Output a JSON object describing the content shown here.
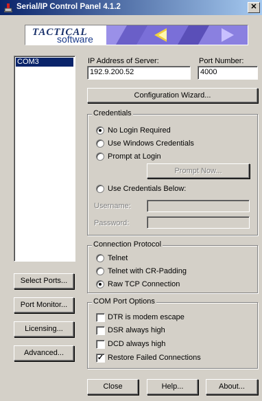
{
  "window": {
    "title": "Serial/IP Control Panel 4.1.2",
    "close_glyph": "✕"
  },
  "banner": {
    "logo_top": "TACTICAL",
    "logo_bottom": "software"
  },
  "ports": {
    "items": [
      "COM3"
    ],
    "selected": "COM3"
  },
  "server": {
    "ip_label": "IP Address of Server:",
    "ip_value": "192.9.200.52",
    "port_label": "Port Number:",
    "port_value": "4000"
  },
  "buttons": {
    "config_wizard": "Configuration Wizard...",
    "prompt_now": "Prompt Now...",
    "select_ports": "Select Ports...",
    "port_monitor": "Port Monitor...",
    "licensing": "Licensing...",
    "advanced": "Advanced...",
    "close": "Close",
    "help": "Help...",
    "about": "About..."
  },
  "credentials": {
    "legend": "Credentials",
    "options": [
      "No Login Required",
      "Use Windows Credentials",
      "Prompt at Login",
      "Use Credentials Below:"
    ],
    "selected": "No Login Required",
    "username_label": "Username:",
    "password_label": "Password:"
  },
  "protocol": {
    "legend": "Connection Protocol",
    "options": [
      "Telnet",
      "Telnet with CR-Padding",
      "Raw TCP Connection"
    ],
    "selected": "Raw TCP Connection"
  },
  "com_options": {
    "legend": "COM Port Options",
    "options": [
      {
        "label": "DTR is modem escape",
        "checked": false
      },
      {
        "label": "DSR always high",
        "checked": false
      },
      {
        "label": "DCD always high",
        "checked": false
      },
      {
        "label": "Restore Failed Connections",
        "checked": true
      }
    ],
    "check_glyph": "✓"
  },
  "colors": {
    "titlebar_start": "#0a246a",
    "titlebar_end": "#a6caf0",
    "face": "#d4d0c8",
    "selection": "#0a246a"
  }
}
